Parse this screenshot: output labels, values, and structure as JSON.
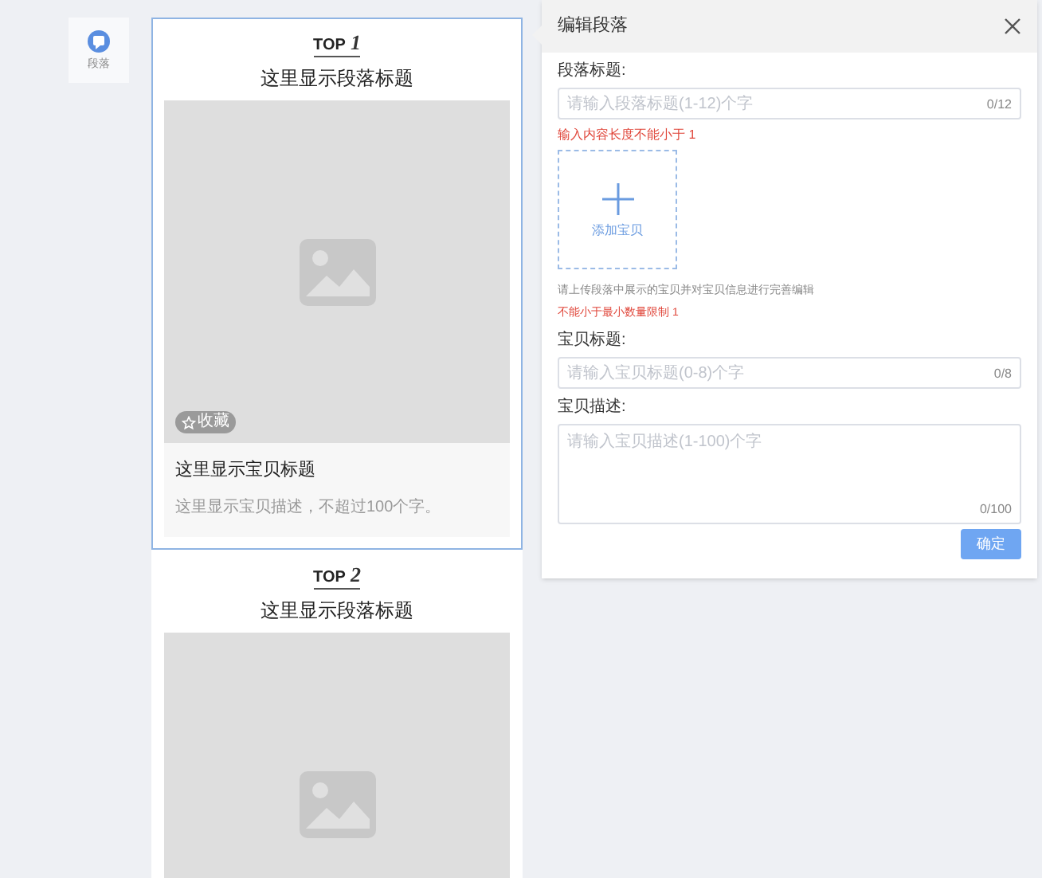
{
  "sidebar": {
    "items": [
      {
        "label": "段落",
        "selected": true
      }
    ]
  },
  "sections": [
    {
      "top_label": "TOP",
      "top_number": "1",
      "title": "这里显示段落标题",
      "selected": true,
      "item": {
        "badge": "收藏",
        "title": "这里显示宝贝标题",
        "description": "这里显示宝贝描述，不超过100个字。"
      }
    },
    {
      "top_label": "TOP",
      "top_number": "2",
      "title": "这里显示段落标题",
      "selected": false
    }
  ],
  "panel": {
    "title": "编辑段落",
    "section_title": {
      "label": "段落标题:",
      "placeholder": "请输入段落标题(1-12)个字",
      "count": "0/12",
      "error": "输入内容长度不能小于 1"
    },
    "add_item": {
      "label": "添加宝贝"
    },
    "hint": "请上传段落中展示的宝贝并对宝贝信息进行完善编辑",
    "hint_error": "不能小于最小数量限制 1",
    "item_title": {
      "label": "宝贝标题:",
      "placeholder": "请输入宝贝标题(0-8)个字",
      "count": "0/8"
    },
    "item_description": {
      "label": "宝贝描述:",
      "placeholder": "请输入宝贝描述(1-100)个字",
      "count": "0/100"
    },
    "confirm_button": "确定"
  }
}
